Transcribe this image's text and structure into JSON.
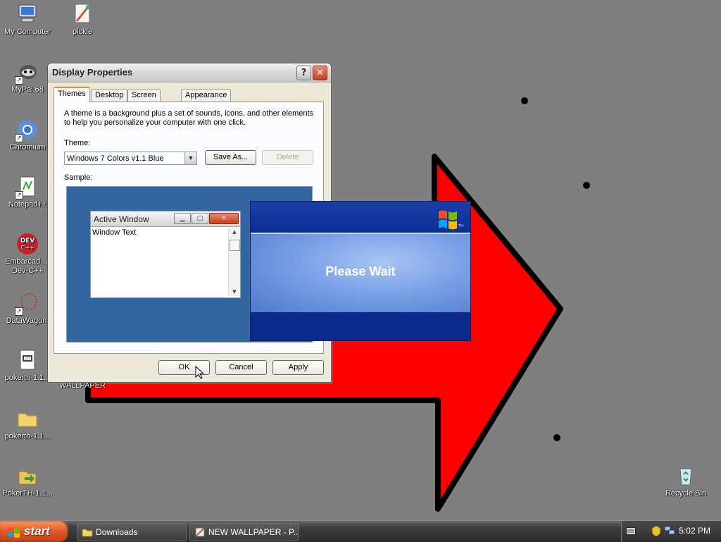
{
  "desktop": {
    "icons": [
      {
        "label": "My Computer"
      },
      {
        "label": "pickle"
      },
      {
        "label": "MyPal 68"
      },
      {
        "label": "Chromium"
      },
      {
        "label": "Notepad++"
      },
      {
        "label": "Embarcadero Dev-C++"
      },
      {
        "label": "DataWagon."
      },
      {
        "label": "pokerth-1.1..."
      },
      {
        "label": "WALLPAPER"
      },
      {
        "label": "pokerth-1.1..."
      },
      {
        "label": "PokerTH-1.1..."
      },
      {
        "label": "Recycle Bin"
      }
    ]
  },
  "dialog": {
    "title": "Display Properties",
    "help_glyph": "?",
    "close_glyph": "✕",
    "tabs": [
      {
        "label": "Themes",
        "active": true
      },
      {
        "label": "Desktop"
      },
      {
        "label": "Screen Saver"
      },
      {
        "label": "Appearance"
      }
    ],
    "description_line1": "A theme is a background plus a set of sounds, icons, and other elements",
    "description_line2": "to help you personalize your computer with one click.",
    "theme_label": "Theme:",
    "theme_value": "Windows 7 Colors v1.1 Blue",
    "save_as_label": "Save As...",
    "delete_label": "Delete",
    "sample_label": "Sample:",
    "sample_window": {
      "title": "Active Window",
      "body_text": "Window Text"
    },
    "ok_label": "OK",
    "cancel_label": "Cancel",
    "apply_label": "Apply"
  },
  "splash": {
    "message": "Please Wait",
    "logo_tm": "TM"
  },
  "taskbar": {
    "start_label": "start",
    "tasks": [
      {
        "label": "Downloads"
      },
      {
        "label": "NEW WALLPAPER - P..."
      }
    ],
    "clock": "5:02 PM"
  },
  "colors": {
    "desktop_bg": "#7f7f7f",
    "arrow_fill": "#ff0000",
    "arrow_stroke": "#000000",
    "start_button": "#e0572b",
    "splash_blue": "#0a2e90"
  }
}
